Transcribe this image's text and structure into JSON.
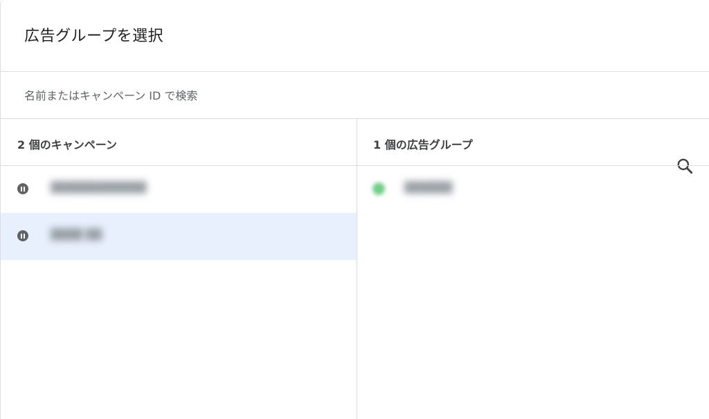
{
  "dialog": {
    "title": "広告グループを選択"
  },
  "search": {
    "placeholder": "名前またはキャンペーン ID で検索",
    "value": "",
    "icon": "search-icon"
  },
  "columns": {
    "campaigns_header": "2 個のキャンペーン",
    "ad_groups_header": "1 個の広告グループ"
  },
  "campaigns": [
    {
      "status": "paused",
      "name": "████████████",
      "selected": false
    },
    {
      "status": "paused",
      "name": "████ ██",
      "selected": true
    }
  ],
  "ad_groups": [
    {
      "status": "enabled",
      "name": "██████"
    }
  ],
  "colors": {
    "selected_row": "#e8f0fe",
    "divider": "#dadce0",
    "paused_icon": "#5f6368",
    "enabled_dot": "#34a853"
  }
}
